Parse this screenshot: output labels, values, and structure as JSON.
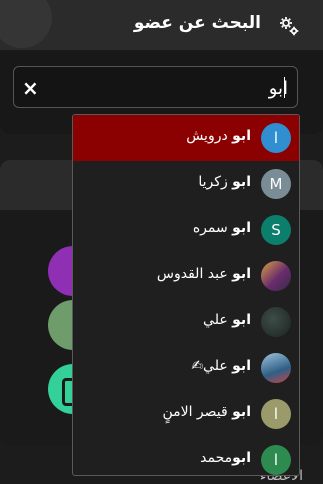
{
  "header": {
    "title": "البحث عن عضو",
    "icon": "gear-icon"
  },
  "search": {
    "value": "ابو",
    "clear_symbol": "×",
    "caret_symbol": ""
  },
  "background": {
    "bottom_text": "الأعضاء"
  },
  "dropdown": {
    "items": [
      {
        "bold": "ابو",
        "rest": " درويش",
        "initial": "ا",
        "color": "#2f8fd0",
        "active": true
      },
      {
        "bold": "ابو",
        "rest": " زكريا",
        "initial": "M",
        "color": "#7a8c95",
        "active": false
      },
      {
        "bold": "ابو",
        "rest": " سمره",
        "initial": "S",
        "color": "#0b7e6c",
        "active": false
      },
      {
        "bold": "ابو",
        "rest": " عبد القدوس",
        "initial": "",
        "color": "#5a3d6a",
        "active": false
      },
      {
        "bold": "ابو",
        "rest": " علي",
        "initial": "",
        "color": "#2b3a34",
        "active": false
      },
      {
        "bold": "ابو",
        "rest": " علي✍",
        "initial": "",
        "color": "#3d6f95",
        "active": false
      },
      {
        "bold": "ابو",
        "rest": " قيصر الامنٍ",
        "initial": "ا",
        "color": "#9a9a6a",
        "active": false
      },
      {
        "bold": "ابو",
        "rest": "محمد",
        "initial": "ا",
        "color": "#2e8b4f",
        "active": false
      }
    ]
  }
}
